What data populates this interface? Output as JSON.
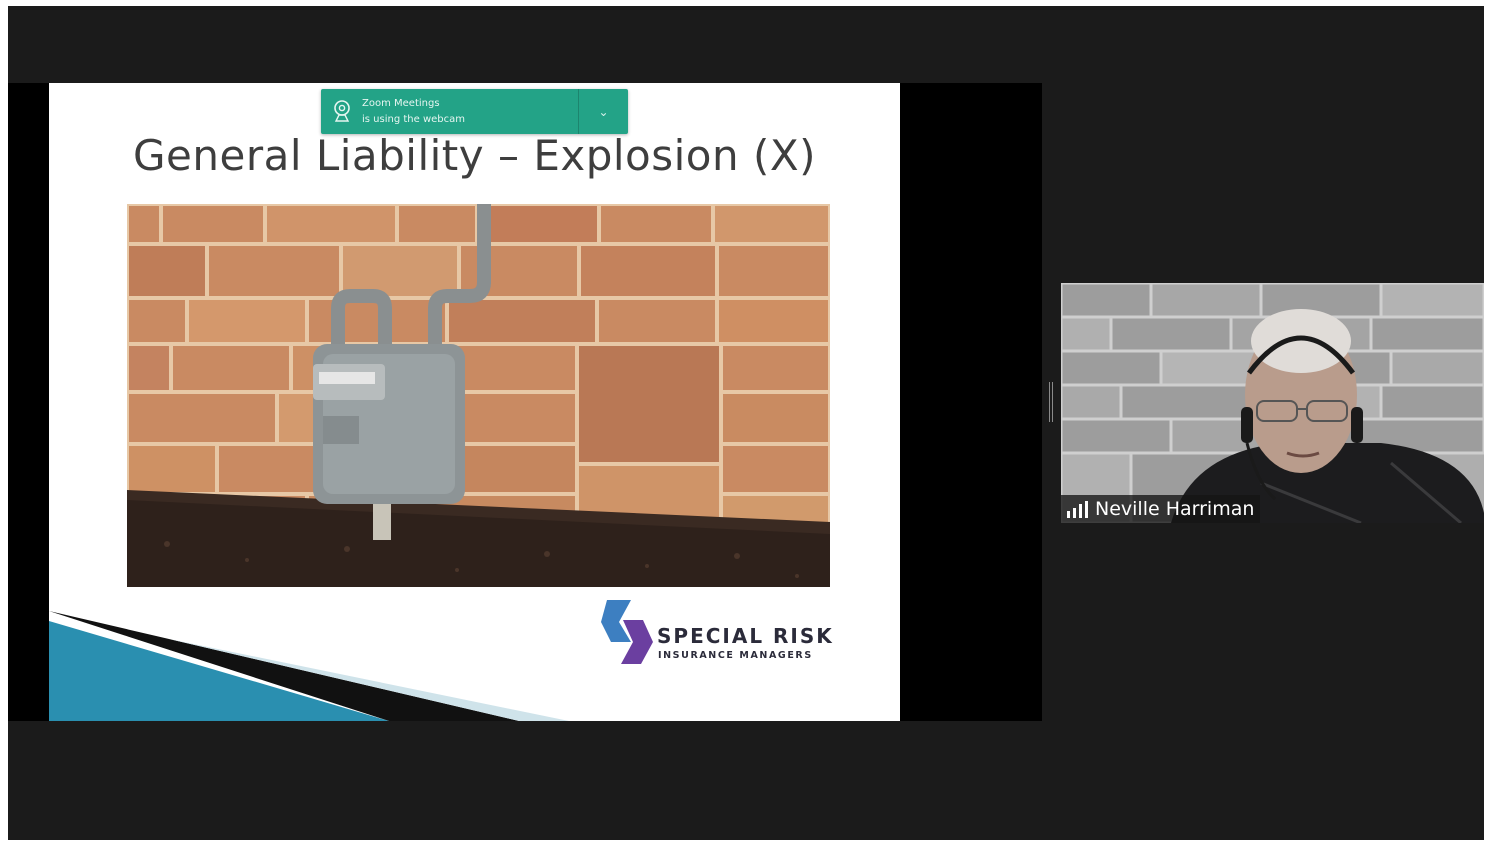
{
  "slide": {
    "title": "General Liability – Explosion (X)",
    "logo": {
      "name": "SPECIAL RISK",
      "tagline": "INSURANCE MANAGERS"
    }
  },
  "notification": {
    "line1": "Zoom Meetings",
    "line2": "is using the webcam",
    "icon": "webcam-icon",
    "chevron": "chevron-down-icon"
  },
  "participant": {
    "name": "Neville Harriman",
    "signal_icon": "signal-bars-icon"
  },
  "colors": {
    "window_bg": "#1b1b1b",
    "notification_bg": "#23a387",
    "brick": "#c98a62",
    "logo_blue": "#3d7fc1",
    "logo_purple": "#6b3fa0"
  }
}
